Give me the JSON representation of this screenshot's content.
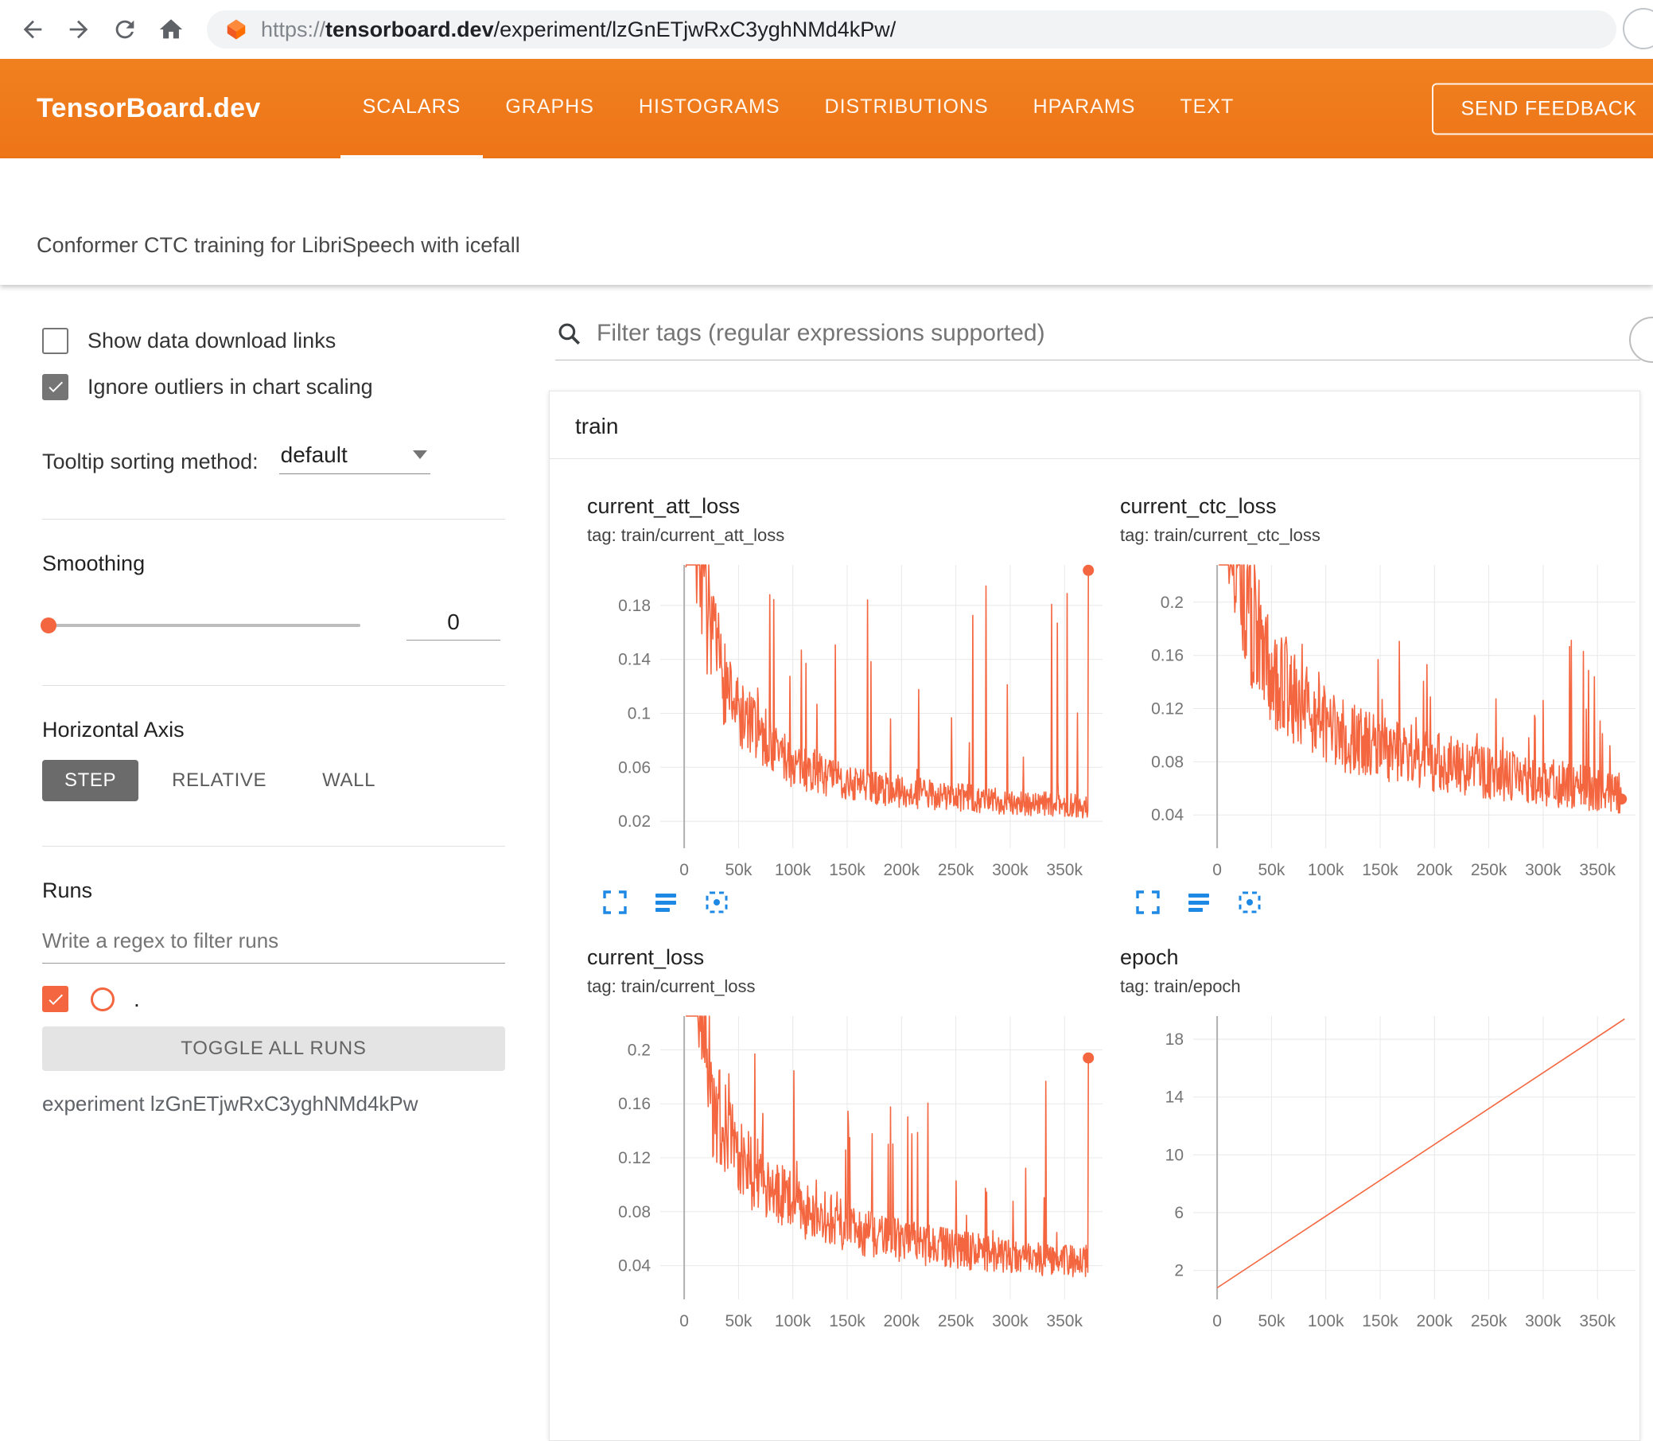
{
  "browser": {
    "url_prefix": "https://",
    "url_domain": "tensorboard.dev",
    "url_path": "/experiment/lzGnETjwRxC3yghNMd4kPw/"
  },
  "header": {
    "title": "TensorBoard.dev",
    "tabs": [
      {
        "label": "SCALARS",
        "active": true
      },
      {
        "label": "GRAPHS",
        "active": false
      },
      {
        "label": "HISTOGRAMS",
        "active": false
      },
      {
        "label": "DISTRIBUTIONS",
        "active": false
      },
      {
        "label": "HPARAMS",
        "active": false
      },
      {
        "label": "TEXT",
        "active": false
      }
    ],
    "feedback_button": "SEND FEEDBACK"
  },
  "experiment": {
    "title": "Conformer CTC training for LibriSpeech with icefall",
    "id_label": "experiment lzGnETjwRxC3yghNMd4kPw"
  },
  "sidebar": {
    "show_download": {
      "label": "Show data download links",
      "checked": false
    },
    "ignore_outliers": {
      "label": "Ignore outliers in chart scaling",
      "checked": true
    },
    "tooltip_sorting": {
      "label": "Tooltip sorting method:",
      "value": "default"
    },
    "smoothing": {
      "label": "Smoothing",
      "value": "0"
    },
    "horizontal_axis": {
      "label": "Horizontal Axis",
      "options": [
        "STEP",
        "RELATIVE",
        "WALL"
      ],
      "selected": "STEP"
    },
    "runs": {
      "label": "Runs",
      "filter_placeholder": "Write a regex to filter runs",
      "run_label": ".",
      "run_checked": true,
      "toggle_button": "TOGGLE ALL RUNS"
    }
  },
  "main": {
    "filter_placeholder": "Filter tags (regular expressions supported)",
    "group_label": "train"
  },
  "colors": {
    "header_orange": "#ee7518",
    "run_line": "#f4663f",
    "icon_blue": "#1e88e5",
    "grid": "#e8e8e8",
    "zero_line": "#b0b0b0",
    "tick_text": "#757575"
  },
  "chart_data": [
    {
      "type": "line",
      "title": "current_att_loss",
      "tag": "tag: train/current_att_loss",
      "xlim": [
        -22000,
        385000
      ],
      "ylim": [
        0.0,
        0.21
      ],
      "xticks": [
        {
          "v": 0,
          "label": "0"
        },
        {
          "v": 50000,
          "label": "50k"
        },
        {
          "v": 100000,
          "label": "100k"
        },
        {
          "v": 150000,
          "label": "150k"
        },
        {
          "v": 200000,
          "label": "200k"
        },
        {
          "v": 250000,
          "label": "250k"
        },
        {
          "v": 300000,
          "label": "300k"
        },
        {
          "v": 350000,
          "label": "350k"
        }
      ],
      "yticks": [
        {
          "v": 0.02,
          "label": "0.02"
        },
        {
          "v": 0.06,
          "label": "0.06"
        },
        {
          "v": 0.1,
          "label": "0.1"
        },
        {
          "v": 0.14,
          "label": "0.14"
        },
        {
          "v": 0.18,
          "label": "0.18"
        }
      ],
      "seed": 7,
      "x_range": [
        1500,
        372000
      ],
      "trend": [
        [
          0,
          0.4
        ],
        [
          10000,
          0.26
        ],
        [
          25000,
          0.15
        ],
        [
          50000,
          0.1
        ],
        [
          100000,
          0.062
        ],
        [
          150000,
          0.048
        ],
        [
          200000,
          0.042
        ],
        [
          250000,
          0.038
        ],
        [
          300000,
          0.034
        ],
        [
          372000,
          0.031
        ]
      ],
      "noise": {
        "jitter": 0.55,
        "spike_prob": 0.085,
        "spike_max": 0.205,
        "spike_pow": 2
      },
      "end_value": 0.206
    },
    {
      "type": "line",
      "title": "current_ctc_loss",
      "tag": "tag: train/current_ctc_loss",
      "xlim": [
        -22000,
        385000
      ],
      "ylim": [
        0.015,
        0.228
      ],
      "xticks": [
        {
          "v": 0,
          "label": "0"
        },
        {
          "v": 50000,
          "label": "50k"
        },
        {
          "v": 100000,
          "label": "100k"
        },
        {
          "v": 150000,
          "label": "150k"
        },
        {
          "v": 200000,
          "label": "200k"
        },
        {
          "v": 250000,
          "label": "250k"
        },
        {
          "v": 300000,
          "label": "300k"
        },
        {
          "v": 350000,
          "label": "350k"
        }
      ],
      "yticks": [
        {
          "v": 0.04,
          "label": "0.04"
        },
        {
          "v": 0.08,
          "label": "0.08"
        },
        {
          "v": 0.12,
          "label": "0.12"
        },
        {
          "v": 0.16,
          "label": "0.16"
        },
        {
          "v": 0.2,
          "label": "0.2"
        }
      ],
      "seed": 13,
      "x_range": [
        1500,
        372000
      ],
      "trend": [
        [
          0,
          0.42
        ],
        [
          10000,
          0.3
        ],
        [
          25000,
          0.2
        ],
        [
          50000,
          0.145
        ],
        [
          100000,
          0.105
        ],
        [
          150000,
          0.09
        ],
        [
          200000,
          0.08
        ],
        [
          250000,
          0.072
        ],
        [
          300000,
          0.065
        ],
        [
          372000,
          0.056
        ]
      ],
      "noise": {
        "jitter": 0.38,
        "spike_prob": 0.08,
        "spike_max": 0.185,
        "spike_pow": 2
      },
      "end_value": 0.052
    },
    {
      "type": "line",
      "title": "current_loss",
      "tag": "tag: train/current_loss",
      "xlim": [
        -22000,
        385000
      ],
      "ylim": [
        0.015,
        0.225
      ],
      "xticks": [
        {
          "v": 0,
          "label": "0"
        },
        {
          "v": 50000,
          "label": "50k"
        },
        {
          "v": 100000,
          "label": "100k"
        },
        {
          "v": 150000,
          "label": "150k"
        },
        {
          "v": 200000,
          "label": "200k"
        },
        {
          "v": 250000,
          "label": "250k"
        },
        {
          "v": 300000,
          "label": "300k"
        },
        {
          "v": 350000,
          "label": "350k"
        }
      ],
      "yticks": [
        {
          "v": 0.04,
          "label": "0.04"
        },
        {
          "v": 0.08,
          "label": "0.08"
        },
        {
          "v": 0.12,
          "label": "0.12"
        },
        {
          "v": 0.16,
          "label": "0.16"
        },
        {
          "v": 0.2,
          "label": "0.2"
        }
      ],
      "seed": 21,
      "x_range": [
        1500,
        372000
      ],
      "trend": [
        [
          0,
          0.5
        ],
        [
          10000,
          0.3
        ],
        [
          25000,
          0.17
        ],
        [
          50000,
          0.12
        ],
        [
          100000,
          0.085
        ],
        [
          150000,
          0.068
        ],
        [
          200000,
          0.058
        ],
        [
          250000,
          0.052
        ],
        [
          300000,
          0.047
        ],
        [
          372000,
          0.043
        ]
      ],
      "noise": {
        "jitter": 0.5,
        "spike_prob": 0.085,
        "spike_max": 0.2,
        "spike_pow": 2
      },
      "end_value": 0.194
    },
    {
      "type": "line",
      "title": "epoch",
      "tag": "tag: train/epoch",
      "xlim": [
        -22000,
        385000
      ],
      "ylim": [
        0,
        19.6
      ],
      "xticks": [
        {
          "v": 0,
          "label": "0"
        },
        {
          "v": 50000,
          "label": "50k"
        },
        {
          "v": 100000,
          "label": "100k"
        },
        {
          "v": 150000,
          "label": "150k"
        },
        {
          "v": 200000,
          "label": "200k"
        },
        {
          "v": 250000,
          "label": "250k"
        },
        {
          "v": 300000,
          "label": "300k"
        },
        {
          "v": 350000,
          "label": "350k"
        }
      ],
      "yticks": [
        {
          "v": 2,
          "label": "2"
        },
        {
          "v": 6,
          "label": "6"
        },
        {
          "v": 10,
          "label": "10"
        },
        {
          "v": 14,
          "label": "14"
        },
        {
          "v": 18,
          "label": "18"
        }
      ],
      "seed": 1,
      "x_range": [
        0,
        375000
      ],
      "trend": [
        [
          0,
          0.8
        ],
        [
          375000,
          19.4
        ]
      ],
      "noise": null,
      "end_value": null
    }
  ]
}
